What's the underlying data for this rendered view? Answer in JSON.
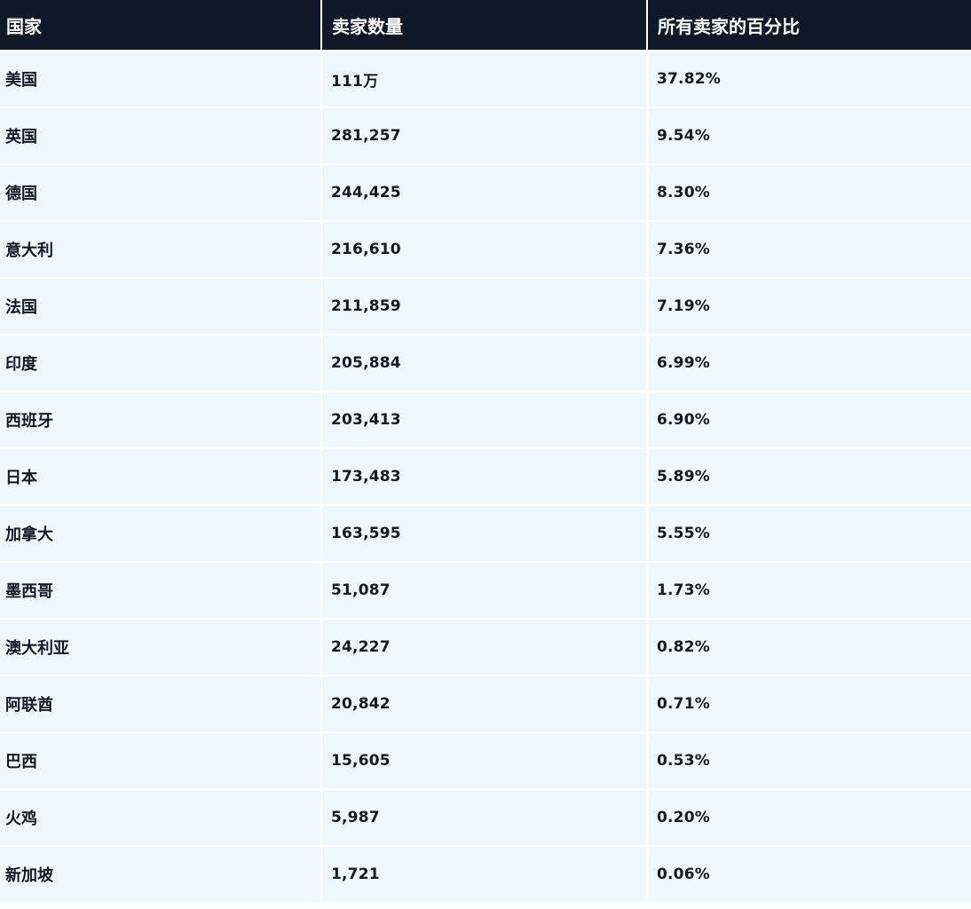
{
  "table": {
    "headers": [
      "国家",
      "卖家数量",
      "所有卖家的百分比"
    ],
    "rows": [
      [
        "美国",
        "111万",
        "37.82%"
      ],
      [
        "英国",
        "281,257",
        "9.54%"
      ],
      [
        "德国",
        "244,425",
        "8.30%"
      ],
      [
        "意大利",
        "216,610",
        "7.36%"
      ],
      [
        "法国",
        "211,859",
        "7.19%"
      ],
      [
        "印度",
        "205,884",
        "6.99%"
      ],
      [
        "西班牙",
        "203,413",
        "6.90%"
      ],
      [
        "日本",
        "173,483",
        "5.89%"
      ],
      [
        "加拿大",
        "163,595",
        "5.55%"
      ],
      [
        "墨西哥",
        "51,087",
        "1.73%"
      ],
      [
        "澳大利亚",
        "24,227",
        "0.82%"
      ],
      [
        "阿联酋",
        "20,842",
        "0.71%"
      ],
      [
        "巴西",
        "15,605",
        "0.53%"
      ],
      [
        "火鸡",
        "5,987",
        "0.20%"
      ],
      [
        "新加坡",
        "1,721",
        "0.06%"
      ]
    ]
  },
  "colors": {
    "header_bg": "#111827",
    "header_text": "#ffffff",
    "row_bg": "#eef7fe",
    "row_text": "#111827",
    "grid_line": "#ffffff"
  }
}
